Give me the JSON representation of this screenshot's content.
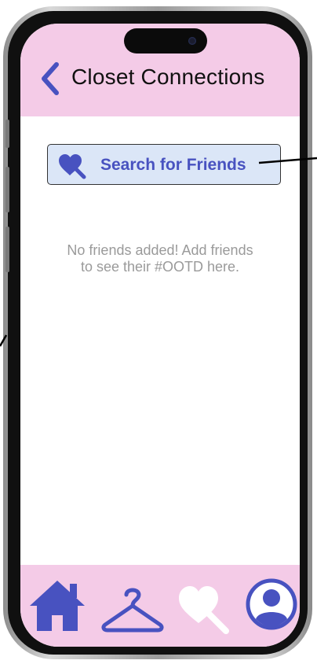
{
  "header": {
    "title": "Closet Connections",
    "back_icon": "chevron-left-icon"
  },
  "search": {
    "button_label": "Search for Friends",
    "icon": "heart-magnifier-icon"
  },
  "empty_state": {
    "message": "No friends added! Add friends to see their #OOTD here."
  },
  "bottom_nav": {
    "items": [
      {
        "icon": "home-icon",
        "active": false
      },
      {
        "icon": "hanger-icon",
        "active": false
      },
      {
        "icon": "heart-magnifier-icon",
        "active": true
      },
      {
        "icon": "profile-icon",
        "active": false
      }
    ]
  },
  "colors": {
    "accent": "#4852c0",
    "header_bg": "#f4cbe7",
    "button_bg": "#dbe6f7",
    "active_icon": "#ffffff"
  }
}
